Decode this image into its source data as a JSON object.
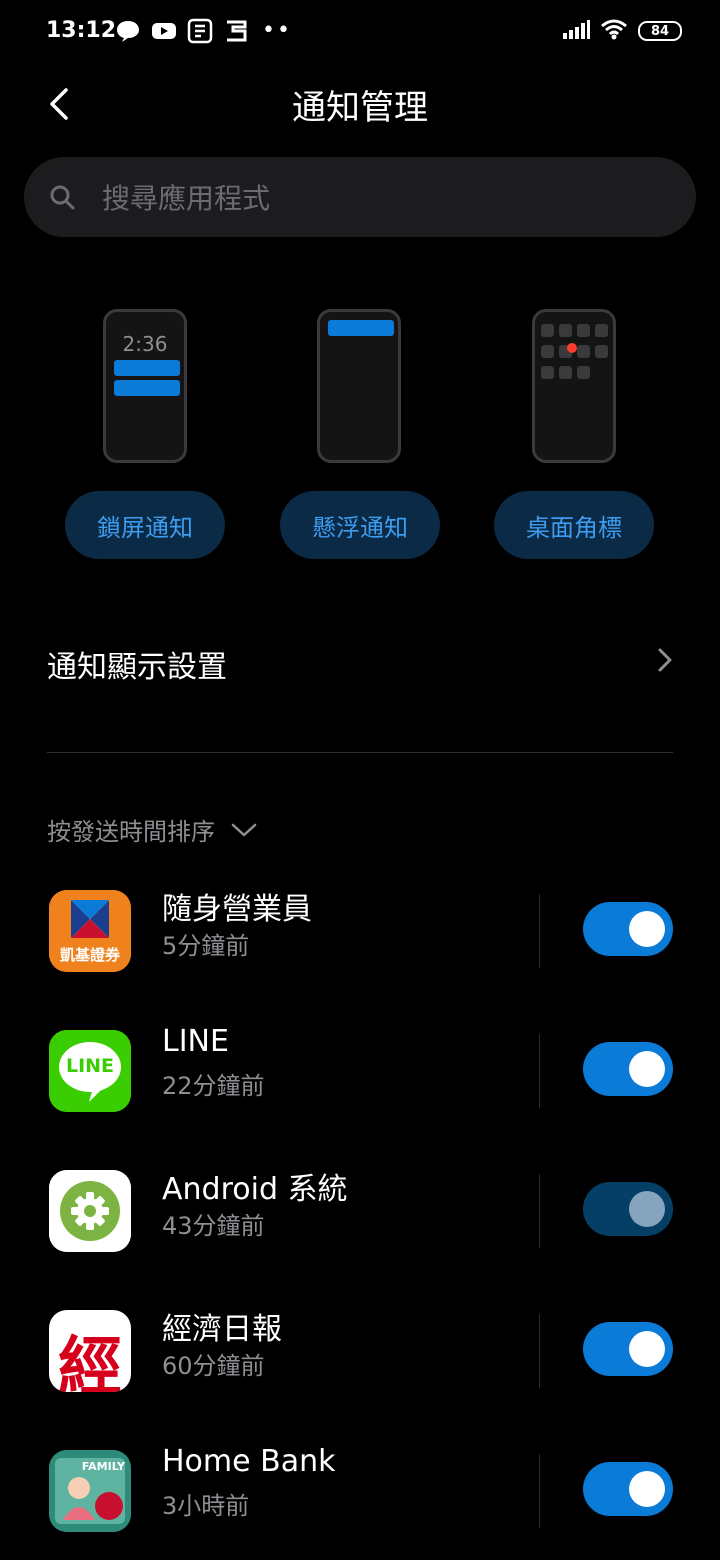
{
  "status_bar": {
    "time": "13:12",
    "battery": "84",
    "left_icons": [
      "chat-bubble-icon",
      "youtube-icon",
      "news-icon",
      "stock-app-icon"
    ],
    "right_icons": [
      "signal-icon",
      "wifi-icon",
      "battery-icon"
    ]
  },
  "header": {
    "title": "通知管理"
  },
  "search": {
    "placeholder": "搜尋應用程式"
  },
  "styles": {
    "lock_preview_time": "2:36",
    "lock_screen_label": "鎖屏通知",
    "floating_label": "懸浮通知",
    "badge_label": "桌面角標"
  },
  "display_settings": {
    "label": "通知顯示設置"
  },
  "sort": {
    "label": "按發送時間排序"
  },
  "apps": [
    {
      "name": "隨身營業員",
      "time": "5分鐘前",
      "enabled": true,
      "icon_text": "凱基證券"
    },
    {
      "name": "LINE",
      "time": "22分鐘前",
      "enabled": true,
      "icon_text": "LINE"
    },
    {
      "name": "Android 系統",
      "time": "43分鐘前",
      "enabled": true,
      "disabled_style": true
    },
    {
      "name": "經濟日報",
      "time": "60分鐘前",
      "enabled": true,
      "icon_text": "經"
    },
    {
      "name": "Home Bank",
      "time": "3小時前",
      "enabled": true,
      "icon_text": "FAMILY"
    }
  ],
  "colors": {
    "accent": "#0a7bd7",
    "pill_bg": "#0b2a45",
    "pill_text": "#3d9cf0",
    "background": "#000000"
  }
}
